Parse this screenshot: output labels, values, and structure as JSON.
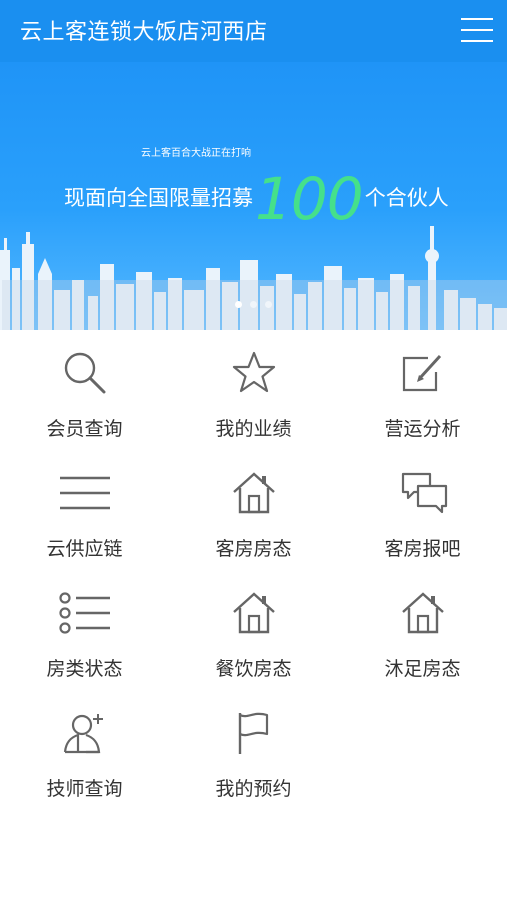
{
  "header": {
    "title": "云上客连锁大饭店河西店",
    "menu_icon": "hamburger-menu-icon"
  },
  "banner": {
    "small_text": "云上客百合大战正在打响",
    "main_prefix": "现面向全国限量招募",
    "main_number": "100",
    "main_suffix": "个合伙人",
    "slides_total": 3,
    "active_slide": 1
  },
  "colors": {
    "header": "#1a8ff0",
    "accent_number": "#45e08b",
    "icon": "#666666",
    "label": "#333333"
  },
  "menu": [
    {
      "label": "会员查询",
      "icon": "search-icon"
    },
    {
      "label": "我的业绩",
      "icon": "star-icon"
    },
    {
      "label": "营运分析",
      "icon": "edit-icon"
    },
    {
      "label": "云供应链",
      "icon": "lines-icon"
    },
    {
      "label": "客房房态",
      "icon": "house-icon"
    },
    {
      "label": "客房报吧",
      "icon": "chat-icon"
    },
    {
      "label": "房类状态",
      "icon": "list-icon"
    },
    {
      "label": "餐饮房态",
      "icon": "house-icon"
    },
    {
      "label": "沐足房态",
      "icon": "house-icon"
    },
    {
      "label": "技师查询",
      "icon": "user-add-icon"
    },
    {
      "label": "我的预约",
      "icon": "flag-icon"
    }
  ]
}
